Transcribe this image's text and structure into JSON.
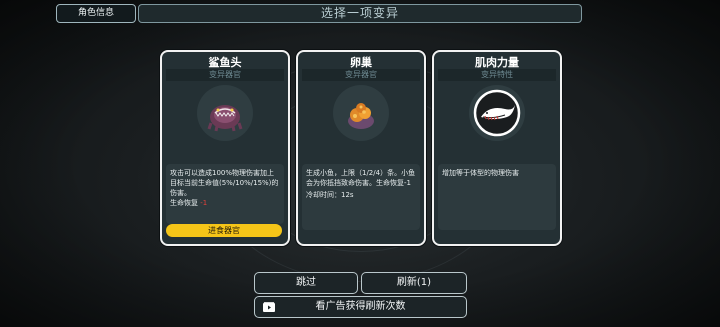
{
  "header": {
    "info_button": "角色信息",
    "title": "选择一项变异"
  },
  "cards": [
    {
      "name": "鲨鱼头",
      "subtitle": "变异器官",
      "icon": "shark-head-icon",
      "description": "攻击可以造成100%物理伤害加上目标当前生命值(5%/10%/15%)的伤害。",
      "regen_label": "生命恢复",
      "regen_value": "-1",
      "button": "进食器官"
    },
    {
      "name": "卵巢",
      "subtitle": "变异器官",
      "icon": "ovary-icon",
      "description": "生成小鱼，上限（1/2/4）条。小鱼会为你抵挡致命伤害。生命恢复-1",
      "cooldown": "冷却时间：12s"
    },
    {
      "name": "肌肉力量",
      "subtitle": "变异特性",
      "icon": "whale-icon",
      "description": "增加等于体型的物理伤害"
    }
  ],
  "footer": {
    "skip_label": "跳过",
    "refresh_label": "刷新(1)",
    "ad_label": "看广告获得刷新次数"
  }
}
